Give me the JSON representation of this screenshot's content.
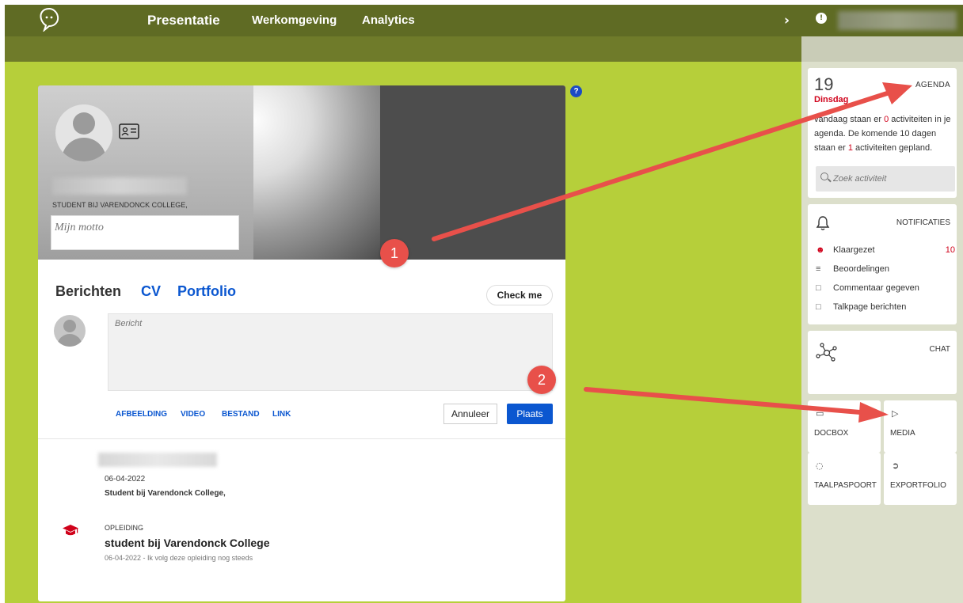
{
  "nav": {
    "logo_icon": "speech-bubble-logo",
    "presentatie": "Presentatie",
    "werkomgeving": "Werkomgeving",
    "analytics": "Analytics",
    "chevron": "›"
  },
  "profile": {
    "student_line": "STUDENT BIJ VARENDONCK COLLEGE,",
    "motto_placeholder": "Mijn motto"
  },
  "tabs": {
    "berichten": "Berichten",
    "cv": "CV",
    "portfolio": "Portfolio"
  },
  "check_me": "Check me",
  "composer": {
    "placeholder": "Bericht",
    "actions": [
      "AFBEELDING",
      "VIDEO",
      "BESTAND",
      "LINK"
    ],
    "cancel": "Annuleer",
    "submit": "Plaats"
  },
  "post": {
    "date": "06-04-2022",
    "subtitle": "Student bij Varendonck College,"
  },
  "education": {
    "type": "OPLEIDING",
    "title": "student bij Varendonck College",
    "meta": "06-04-2022 - Ik volg deze opleiding nog steeds"
  },
  "help": "?",
  "agenda": {
    "day": "19",
    "weekday": "Dinsdag",
    "title": "AGENDA",
    "text_a": "vandaag staan er ",
    "count_today": "0",
    "text_b": " activiteiten in je agenda. De komende 10 dagen staan er ",
    "count_upcoming": "1",
    "text_c": " activiteiten gepland.",
    "search_placeholder": "Zoek activiteit"
  },
  "notifications": {
    "title": "NOTIFICATIES",
    "items": [
      {
        "icon": "user-check-icon",
        "label": "Klaargezet",
        "count": "10"
      },
      {
        "icon": "sliders-icon",
        "label": "Beoordelingen",
        "count": ""
      },
      {
        "icon": "comment-icon",
        "label": "Commentaar gegeven",
        "count": ""
      },
      {
        "icon": "message-icon",
        "label": "Talkpage berichten",
        "count": ""
      }
    ]
  },
  "chat": {
    "title": "CHAT"
  },
  "tiles": {
    "docbox": "DOCBOX",
    "media": "MEDIA",
    "taalpaspoort": "TAALPASPOORT",
    "exportfolio": "EXPORTFOLIO"
  },
  "annotations": {
    "marker_1": "1",
    "marker_2": "2",
    "arrow_color": "#e8504a"
  },
  "colors": {
    "background": "#b6cf3a",
    "topbar": "#5f6b24",
    "accent_blue": "#0b57d0",
    "accent_red": "#d0021b"
  }
}
